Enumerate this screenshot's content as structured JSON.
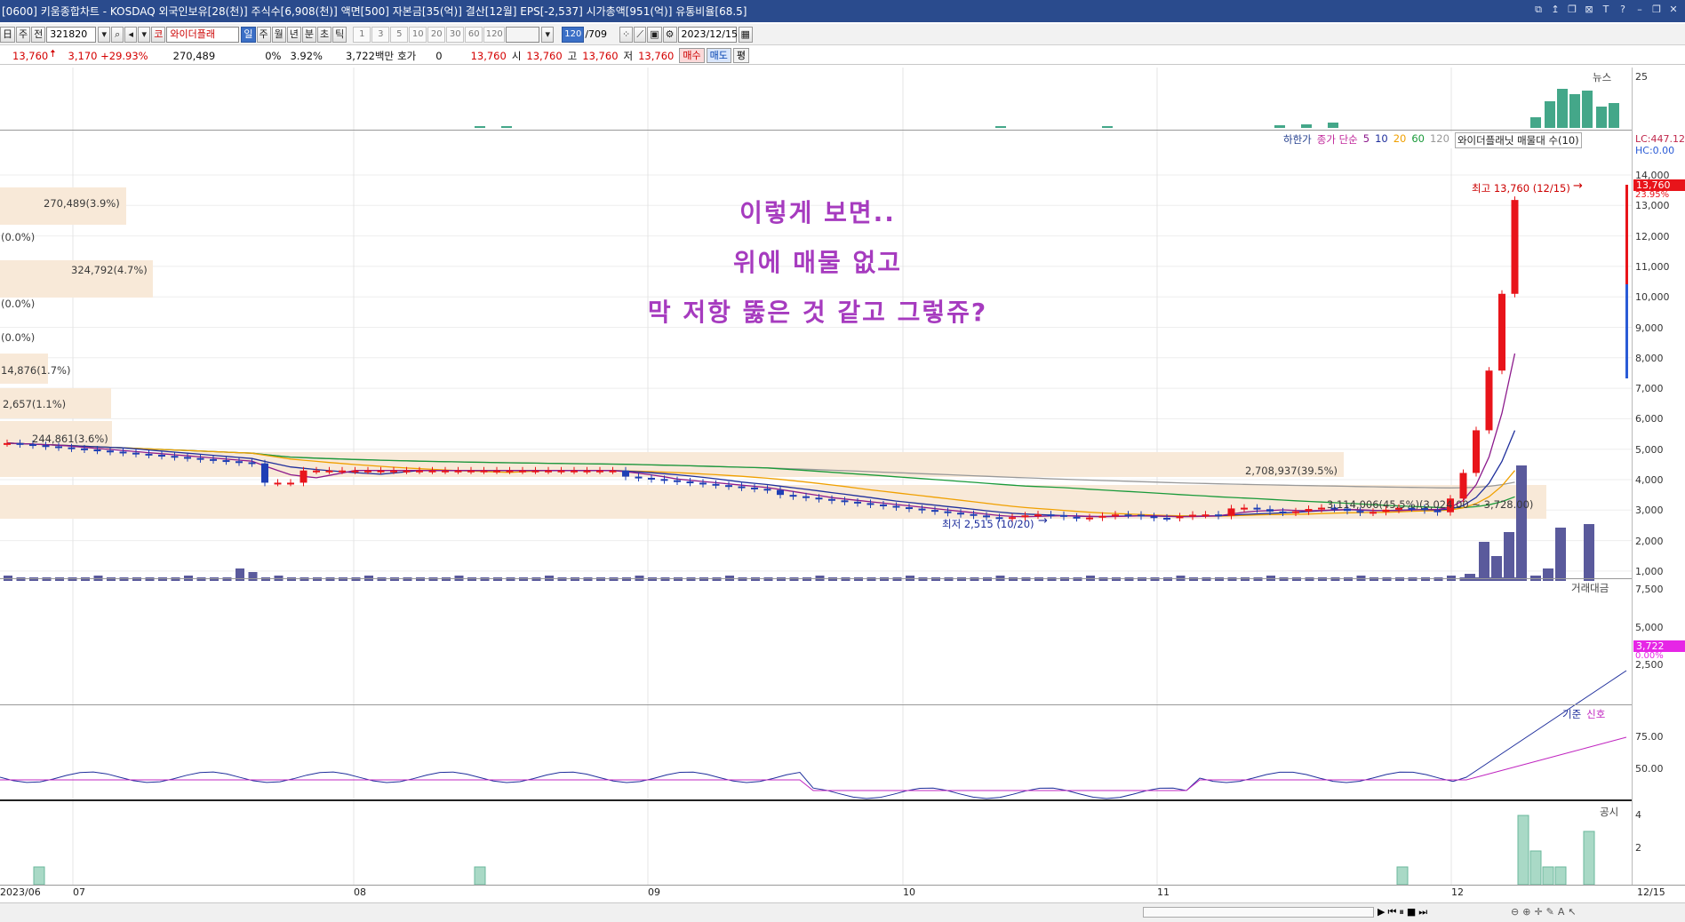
{
  "window": {
    "title": "[0600] 키움종합차트 - KOSDAQ 외국인보유[28(천)] 주식수[6,908(천)] 액면[500] 자본금[35(억)] 결산[12월] EPS[-2,537] 시가총액[951(억)] 유통비율[68.5]",
    "controls": [
      "⧉",
      "↥",
      "❐",
      "⊠",
      "T",
      "?",
      "–",
      "❐",
      "✕"
    ]
  },
  "toolbar": {
    "period_btns": [
      "日",
      "주",
      "전"
    ],
    "code": "321820",
    "name_badge": "코",
    "stock_name": "와이더플래",
    "interval_btns": [
      "일",
      "주",
      "월",
      "년",
      "분",
      "초",
      "틱"
    ],
    "num_btns": [
      "1",
      "3",
      "5",
      "10",
      "20",
      "30",
      "60",
      "120"
    ],
    "count_badge": "120",
    "count_total": "/709",
    "date": "2023/12/15"
  },
  "quote": {
    "price": "13,760",
    "change": "3,170 +29.93%",
    "volume": "270,489",
    "pct0": "0%",
    "turnover": "3.92%",
    "amount": "3,722백만",
    "hoga_label": "호가",
    "hoga_val": "0",
    "ask": "13,760",
    "open_label": "시",
    "open": "13,760",
    "high_label": "고",
    "high": "13,760",
    "low_label": "저",
    "low": "13,760",
    "buy": "매수",
    "sell": "매도",
    "eval": "평"
  },
  "panes": {
    "news_label": "뉴스",
    "news_axis": "25",
    "legend": {
      "limit": "하한가",
      "ma_label": "종가 단순",
      "ma_periods": [
        "5",
        "10",
        "20",
        "60",
        "120"
      ],
      "vp_label": "와이더플래닛 매물대 수(10)"
    },
    "lc": "LC:447.12",
    "hc": "HC:0.00",
    "price_tag": "13,760",
    "price_pct": "23.95%",
    "price_axis": [
      "14,000",
      "13,000",
      "12,000",
      "11,000",
      "10,000",
      "9,000",
      "8,000",
      "7,000",
      "6,000",
      "5,000",
      "4,000",
      "3,000",
      "2,000",
      "1,000"
    ],
    "high_note": "최고 13,760 (12/15)",
    "low_note": "최저 2,515 (10/20)",
    "volume_profile": [
      "270,489(3.9%)",
      "(0.0%)",
      "324,792(4.7%)",
      "(0.0%)",
      "(0.0%)",
      "14,876(1.7%)",
      "2,657(1.1%)",
      "244,861(3.6%)",
      "2,708,937(39.5%)",
      "3,114,006(45.5%)(3,024.00 ~ 3,728.00)"
    ],
    "amount_label": "거래대금",
    "amount_axis": [
      "7,500",
      "5,000",
      "2,500"
    ],
    "amount_tag": "3,722",
    "amount_pct": "0.00%",
    "osc_labels": [
      "기준",
      "신호"
    ],
    "osc_axis": [
      "75.00",
      "50.00"
    ],
    "disc_label": "공시",
    "disc_axis": [
      "4",
      "2"
    ],
    "months": [
      "2023/06",
      "07",
      "08",
      "09",
      "10",
      "11",
      "12",
      "12/15"
    ]
  },
  "overlay": {
    "line1": "이렇게 보면..",
    "line2": "위에 매물 없고",
    "line3": "막 저항 뚫은 것 같고 그렇쥬?"
  },
  "colors": {
    "up": "#e8141a",
    "down": "#1f3fb5",
    "ma5": "#8c1a8c",
    "ma10": "#1f2f9c",
    "ma20": "#f0a000",
    "ma60": "#1a9a3a",
    "ma120": "#999999",
    "overlay": "#a63bbf",
    "news": "#44a789",
    "volume": "#5a5a9c"
  }
}
